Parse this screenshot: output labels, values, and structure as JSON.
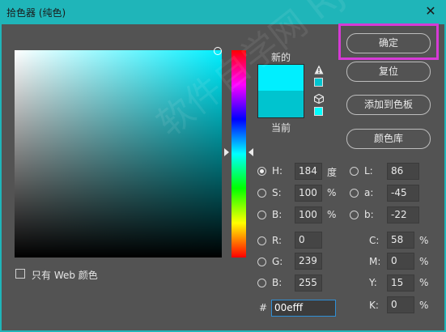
{
  "window": {
    "title": "拾色器 (纯色)",
    "close_glyph": "✕"
  },
  "labels": {
    "new": "新的",
    "current": "当前"
  },
  "colors": {
    "new": "#00efff",
    "current": "#00c4cf",
    "web_safe": "#00ffff",
    "accent_highlight": "#d63ad6",
    "titlebar": "#1fb5b9"
  },
  "buttons": {
    "ok": "确定",
    "reset": "复位",
    "add_to_swatches": "添加到色板",
    "color_libraries": "颜色库"
  },
  "hsb": {
    "h": {
      "label": "H:",
      "value": "184",
      "unit": "度",
      "selected": true
    },
    "s": {
      "label": "S:",
      "value": "100",
      "unit": "%"
    },
    "b": {
      "label": "B:",
      "value": "100",
      "unit": "%"
    }
  },
  "lab": {
    "l": {
      "label": "L:",
      "value": "86"
    },
    "a": {
      "label": "a:",
      "value": "-45"
    },
    "b": {
      "label": "b:",
      "value": "-22"
    }
  },
  "rgb": {
    "r": {
      "label": "R:",
      "value": "0"
    },
    "g": {
      "label": "G:",
      "value": "239"
    },
    "b": {
      "label": "B:",
      "value": "255"
    }
  },
  "cmyk": {
    "c": {
      "label": "C:",
      "value": "58",
      "unit": "%"
    },
    "m": {
      "label": "M:",
      "value": "0",
      "unit": "%"
    },
    "y": {
      "label": "Y:",
      "value": "15",
      "unit": "%"
    },
    "k": {
      "label": "K:",
      "value": "0",
      "unit": "%"
    }
  },
  "hex": {
    "label": "#",
    "value": "00efff"
  },
  "web_only": {
    "label": "只有 Web 颜色",
    "checked": false
  },
  "watermark": "软件自学网 RJZXW.COM",
  "icons": {
    "close": "close-icon",
    "gamut_warning": "warning-triangle-icon",
    "web_warning": "cube-icon"
  }
}
